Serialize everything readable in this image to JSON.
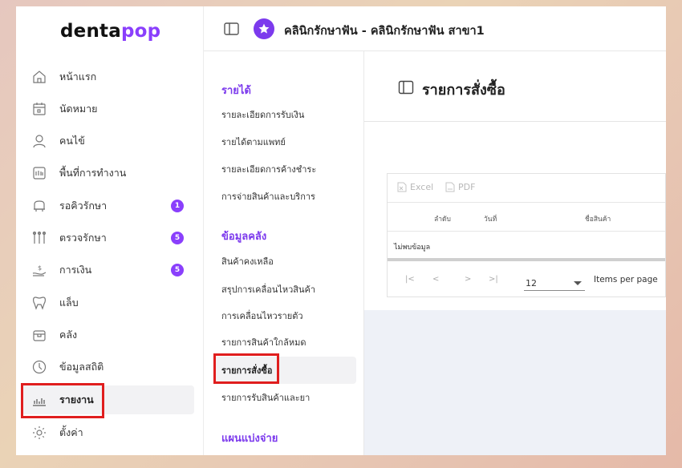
{
  "brand": {
    "name_part1": "denta",
    "name_part2": "pop"
  },
  "header": {
    "clinic_title": "คลินิกรักษาฟัน - คลินิกรักษาฟัน สาขา1"
  },
  "sidebar": {
    "items": [
      {
        "label": "หน้าแรก",
        "icon": "home-icon"
      },
      {
        "label": "นัดหมาย",
        "icon": "calendar-icon"
      },
      {
        "label": "คนไข้",
        "icon": "user-icon"
      },
      {
        "label": "พื้นที่การทำงาน",
        "icon": "workspace-icon"
      },
      {
        "label": "รอคิวรักษา",
        "icon": "dental-chair-icon",
        "badge": "1"
      },
      {
        "label": "ตรวจรักษา",
        "icon": "dental-tools-icon",
        "badge": "5"
      },
      {
        "label": "การเงิน",
        "icon": "money-icon",
        "badge": "5"
      },
      {
        "label": "แล็บ",
        "icon": "tooth-icon"
      },
      {
        "label": "คลัง",
        "icon": "box-icon"
      },
      {
        "label": "ข้อมูลสถิติ",
        "icon": "stats-icon"
      },
      {
        "label": "รายงาน",
        "icon": "report-icon"
      },
      {
        "label": "ตั้งค่า",
        "icon": "gear-icon"
      }
    ]
  },
  "submenu": {
    "sections": [
      {
        "title": "รายได้",
        "items": [
          "รายละเอียดการรับเงิน",
          "รายได้ตามแพทย์",
          "รายละเอียดการค้างชำระ",
          "การจ่ายสินค้าและบริการ"
        ]
      },
      {
        "title": "ข้อมูลคลัง",
        "items": [
          "สินค้าคงเหลือ",
          "สรุปการเคลื่อนไหวสินค้า",
          "การเคลื่อนไหวรายตัว",
          "รายการสินค้าใกล้หมด",
          "รายการสั่งซื้อ",
          "รายการรับสินค้าและยา"
        ]
      },
      {
        "title": "แผนแบ่งจ่าย",
        "items": []
      }
    ]
  },
  "main": {
    "title": "รายการสั่งซื้อ",
    "toolbar": {
      "excel": "Excel",
      "pdf": "PDF"
    },
    "columns": [
      "ลำดับ",
      "วันที่",
      "ชื่อสินค้า"
    ],
    "empty_text": "ไม่พบข้อมูล",
    "pager": {
      "first": "|<",
      "prev": "<",
      "next": ">",
      "last": ">|",
      "page_size": "12",
      "items_per_page": "Items per page"
    }
  },
  "colors": {
    "accent": "#8a3ffc",
    "highlight": "#e01e1e"
  }
}
